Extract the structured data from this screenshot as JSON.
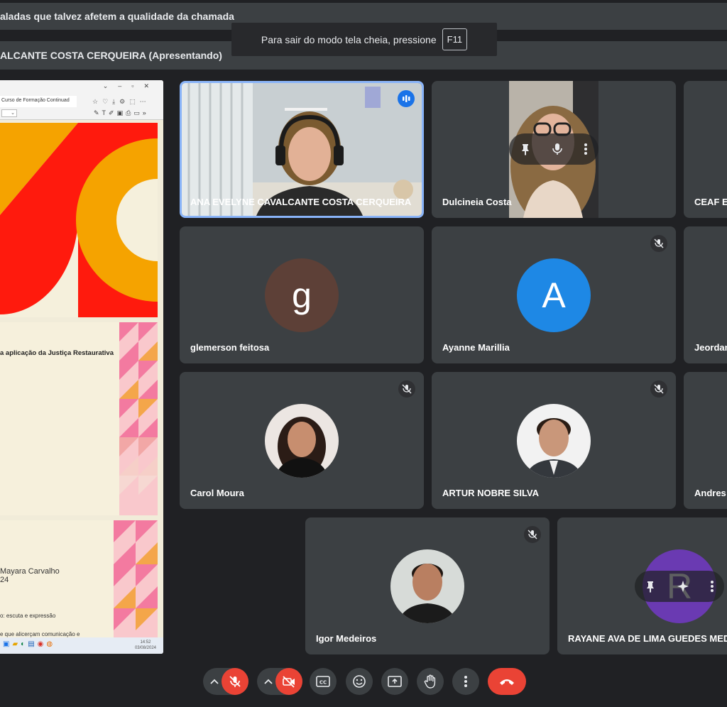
{
  "banners": {
    "warning": "aladas que talvez afetem a qualidade da chamada",
    "presenting": "ALCANTE COSTA CERQUEIRA (Apresentando)"
  },
  "fullscreen_toast": {
    "text": "Para sair do modo tela cheia, pressione",
    "key": "F11"
  },
  "screenshare": {
    "tab_title": "Curso de Formação Continuad",
    "zoom": "",
    "slide2_title": "a aplicação da Justiça Restaurativa",
    "slide3_lines": [
      "Mayara Carvalho",
      "24",
      "o: escuta e expressão",
      "e que alicerçam comunicação e"
    ],
    "taskbar_time": "14:52",
    "taskbar_date": "03/08/2024"
  },
  "participants": [
    {
      "name": "ANA EVELYNE CAVALCANTE COSTA CERQUEIRA",
      "state": "speaking"
    },
    {
      "name": "Dulcineia Costa",
      "state": "video"
    },
    {
      "name": "CEAF E",
      "state": "cut-off"
    },
    {
      "name": "glemerson feitosa",
      "initial": "g",
      "color": "#5d4037"
    },
    {
      "name": "Ayanne Marillia",
      "initial": "A",
      "color": "#1e88e5"
    },
    {
      "name": "Jeordan",
      "state": "cut-off"
    },
    {
      "name": "Carol Moura",
      "state": "photo"
    },
    {
      "name": "ARTUR NOBRE SILVA",
      "state": "photo"
    },
    {
      "name": "Andres",
      "state": "cut-off"
    },
    {
      "name": "Igor Medeiros",
      "state": "photo"
    },
    {
      "name": "RAYANE AVA DE LIMA GUEDES MED",
      "initial": "R",
      "color": "#6a3ab2"
    }
  ],
  "icons": {
    "mic_off": "mic-off-icon",
    "cam_off": "videocam-off-icon",
    "captions": "closed-caption-icon",
    "emoji": "emoji-icon",
    "present": "present-screen-icon",
    "hand": "raise-hand-icon",
    "more": "more-vert-icon",
    "end": "call-end-icon",
    "pin": "pin-icon",
    "mic": "mic-icon",
    "speaking": "audio-level-icon",
    "effects": "sparkle-effects-icon"
  },
  "colors": {
    "background": "#202124",
    "tile": "#3c4043",
    "danger": "#ea4335",
    "speaking": "#1a73e8"
  }
}
